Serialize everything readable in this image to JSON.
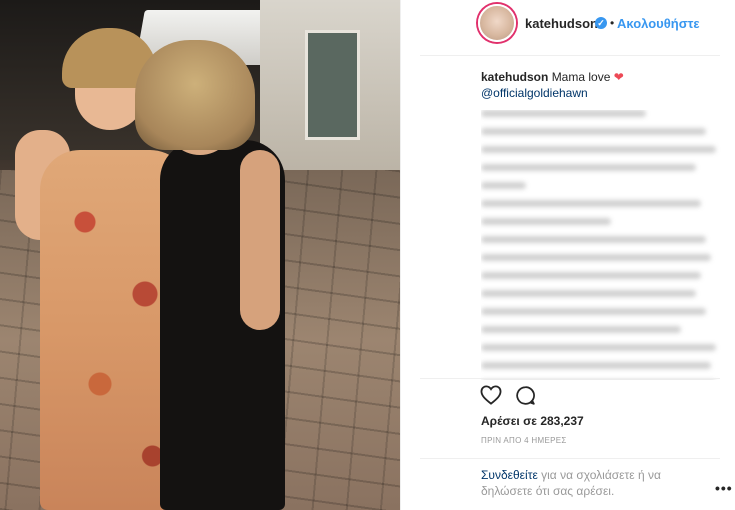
{
  "post": {
    "username": "katehudson",
    "verified": true,
    "follow_separator": "•",
    "follow_label": "Ακολουθήστε",
    "caption_user": "katehudson",
    "caption_text": "Mama love",
    "caption_emoji": "❤",
    "caption_mention": "@officialgoldiehawn",
    "likes_text": "Αρέσει σε 283,237",
    "time_text": "ΠΡΙΝ ΑΠΟ 4 ΗΜΕΡΕΣ",
    "login_link": "Συνδεθείτε",
    "login_rest": " για να σχολιάσετε ή να δηλώσετε ότι σας αρέσει.",
    "more_label": "•••"
  },
  "icons": {
    "verified": "verified-badge-icon",
    "like": "heart-icon",
    "comment": "comment-icon",
    "more": "more-options-icon"
  },
  "colors": {
    "accent_blue": "#3897f0",
    "link_dark": "#003569",
    "heart_red": "#ed4956",
    "muted": "#999999"
  }
}
